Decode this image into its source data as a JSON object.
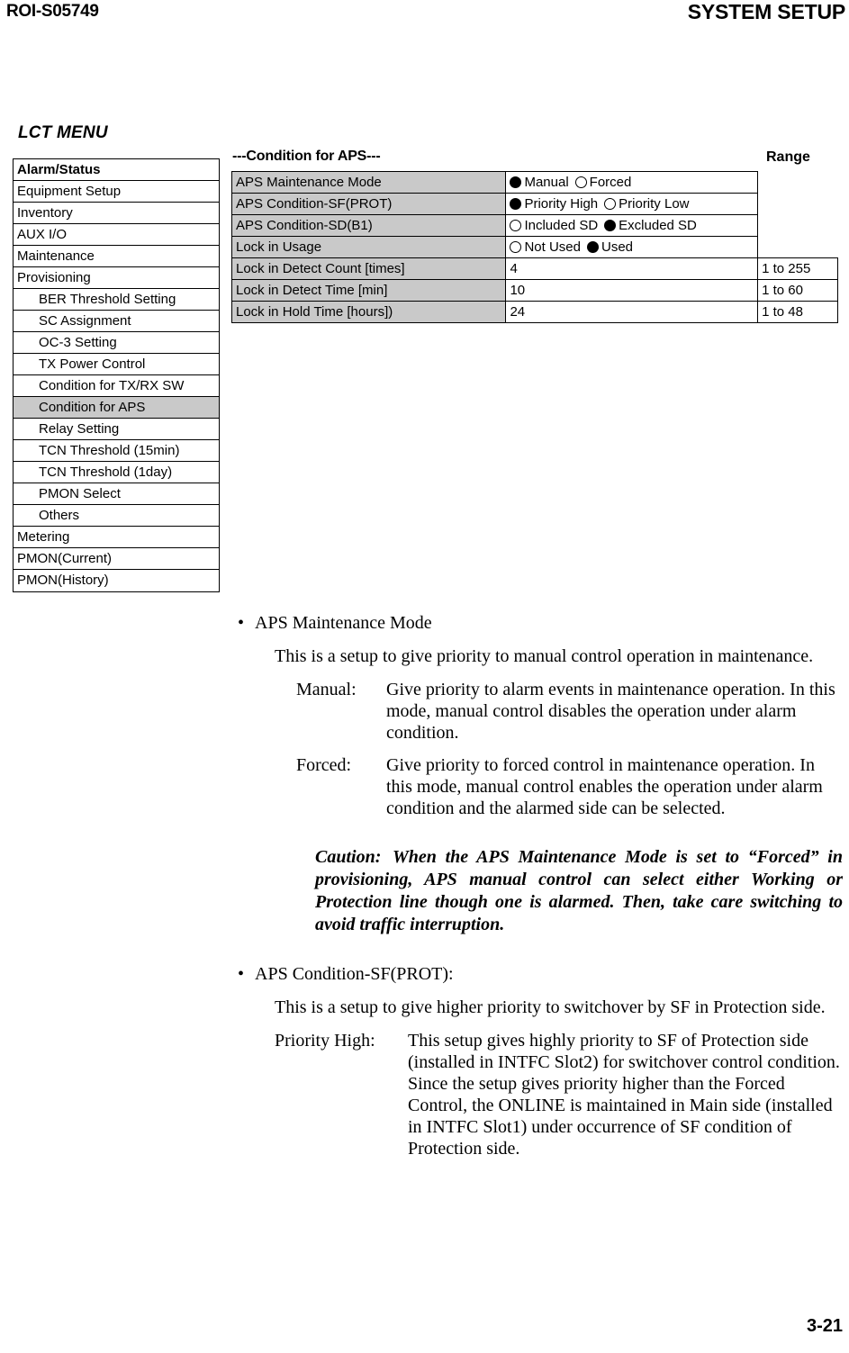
{
  "header": {
    "doc_id": "ROI-S05749",
    "section_title": "SYSTEM SETUP"
  },
  "lct_menu": {
    "caption": "LCT MENU",
    "items": [
      {
        "label": "Alarm/Status",
        "indent": false,
        "bold": true,
        "selected": false
      },
      {
        "label": "Equipment Setup",
        "indent": false,
        "bold": false,
        "selected": false
      },
      {
        "label": "Inventory",
        "indent": false,
        "bold": false,
        "selected": false
      },
      {
        "label": "AUX I/O",
        "indent": false,
        "bold": false,
        "selected": false
      },
      {
        "label": "Maintenance",
        "indent": false,
        "bold": false,
        "selected": false
      },
      {
        "label": "Provisioning",
        "indent": false,
        "bold": false,
        "selected": false
      },
      {
        "label": "BER Threshold Setting",
        "indent": true,
        "bold": false,
        "selected": false
      },
      {
        "label": "SC Assignment",
        "indent": true,
        "bold": false,
        "selected": false
      },
      {
        "label": "OC-3 Setting",
        "indent": true,
        "bold": false,
        "selected": false
      },
      {
        "label": "TX Power Control",
        "indent": true,
        "bold": false,
        "selected": false
      },
      {
        "label": "Condition for TX/RX SW",
        "indent": true,
        "bold": false,
        "selected": false
      },
      {
        "label": "Condition for APS",
        "indent": true,
        "bold": false,
        "selected": true
      },
      {
        "label": "Relay Setting",
        "indent": true,
        "bold": false,
        "selected": false
      },
      {
        "label": "TCN Threshold (15min)",
        "indent": true,
        "bold": false,
        "selected": false
      },
      {
        "label": "TCN Threshold (1day)",
        "indent": true,
        "bold": false,
        "selected": false
      },
      {
        "label": "PMON Select",
        "indent": true,
        "bold": false,
        "selected": false
      },
      {
        "label": "Others",
        "indent": true,
        "bold": false,
        "selected": false
      },
      {
        "label": "Metering",
        "indent": false,
        "bold": false,
        "selected": false
      },
      {
        "label": "PMON(Current)",
        "indent": false,
        "bold": false,
        "selected": false
      },
      {
        "label": "PMON(History)",
        "indent": false,
        "bold": false,
        "selected": false
      }
    ]
  },
  "settings_panel": {
    "title": "---Condition for APS---",
    "range_header": "Range",
    "rows": [
      {
        "label": "APS Maintenance Mode",
        "type": "radio",
        "options": [
          {
            "text": "Manual",
            "selected": true
          },
          {
            "text": "Forced",
            "selected": false
          }
        ],
        "range": ""
      },
      {
        "label": "APS Condition-SF(PROT)",
        "type": "radio",
        "options": [
          {
            "text": "Priority High",
            "selected": true
          },
          {
            "text": "Priority Low",
            "selected": false
          }
        ],
        "range": ""
      },
      {
        "label": "APS Condition-SD(B1)",
        "type": "radio",
        "options": [
          {
            "text": "Included SD",
            "selected": false
          },
          {
            "text": "Excluded SD",
            "selected": true
          }
        ],
        "range": ""
      },
      {
        "label": "Lock in Usage",
        "type": "radio",
        "options": [
          {
            "text": "Not Used",
            "selected": false
          },
          {
            "text": "Used",
            "selected": true
          }
        ],
        "range": ""
      },
      {
        "label": "Lock in Detect Count [times]",
        "type": "value",
        "value": "4",
        "range": "1 to 255"
      },
      {
        "label": "Lock in Detect Time [min]",
        "type": "value",
        "value": "10",
        "range": "1 to 60"
      },
      {
        "label": "Lock in Hold Time [hours])",
        "type": "value",
        "value": "24",
        "range": "1 to 48"
      }
    ]
  },
  "body": {
    "bullet_glyph": "•",
    "section1": {
      "heading": "APS Maintenance Mode",
      "intro": "This is a setup to give priority to manual control operation in maintenance.",
      "definitions": [
        {
          "term": "Manual:",
          "desc": "Give priority to alarm events in maintenance operation. In this mode, manual control disables the operation under alarm condition."
        },
        {
          "term": "Forced:",
          "desc": "Give priority to forced control in maintenance operation. In this mode, manual control enables the operation under alarm condition and the alarmed side can be selected."
        }
      ],
      "caution_label": "Caution:",
      "caution_text": "When the APS Maintenance Mode is set to “Forced” in provisioning, APS manual control can select either Working or Protection line though one is alarmed. Then, take care switching to avoid traffic interruption."
    },
    "section2": {
      "heading": "APS Condition-SF(PROT):",
      "intro": "This is a setup to give higher priority to switchover by SF in Protection side.",
      "definitions": [
        {
          "term": "Priority High:",
          "desc": "This setup gives highly priority to SF of Protection side (installed in INTFC Slot2) for switchover control condition. Since the setup gives priority higher than the Forced Control, the ONLINE is maintained in Main side (installed in INTFC Slot1) under occurrence of SF condition of Protection side."
        }
      ]
    }
  },
  "footer": {
    "page_number": "3-21"
  }
}
